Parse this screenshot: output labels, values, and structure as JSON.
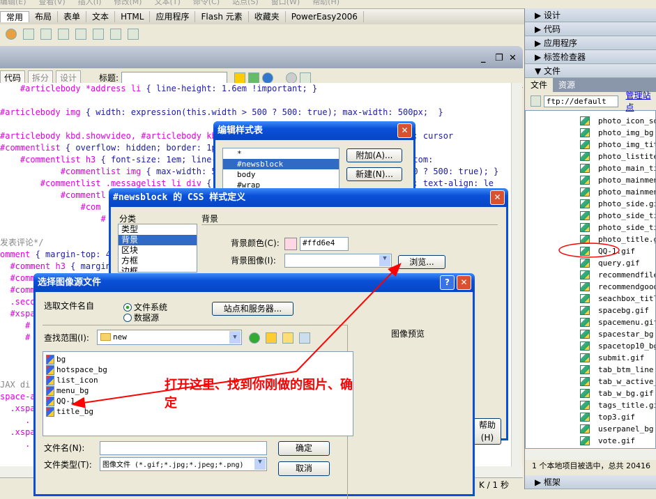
{
  "menubar": [
    "编辑(E)",
    "查看(V)",
    "插入(I)",
    "修改(M)",
    "文本(T)",
    "命令(C)",
    "站点(S)",
    "窗口(W)",
    "帮助(H)"
  ],
  "insert_tabs": [
    "常用",
    "布局",
    "表单",
    "文本",
    "HTML",
    "应用程序",
    "Flash 元素",
    "收藏夹",
    "PowerEasy2006"
  ],
  "doc_toolbar": {
    "code": "代码",
    "split": "拆分",
    "design": "设计",
    "title_label": "标题:",
    "title_value": ""
  },
  "code_lines": [
    {
      "s": "    #articlebody *address li ",
      "b": "{ line-height: 1.6em !important; }"
    },
    {
      "s": "",
      "b": ""
    },
    {
      "s": "#articlebody img ",
      "b": "{ width: expression(this.width > 500 ? 500: true); max-width: 500px;  }"
    },
    {
      "s": "",
      "b": ""
    },
    {
      "s": "#articlebody kbd.showvideo, #articlebody kbd.showvideo a ",
      "b": "{ font-family: sans-serif; cursor"
    },
    {
      "s": "#commentlist ",
      "b": "{ overflow: hidden; border: 1px solid #ccc; padding: 0 5px; }"
    },
    {
      "s": "    #commentlist h3 ",
      "b": "{ font-size: 1em; line-height: 2em; color: #0000FF; border-bottom:"
    },
    {
      "s": "            #commentlist img ",
      "b": "{ max-width: 500px; width: expression(this.width > 500 ? 500: true); }"
    },
    {
      "s": "        #commentlist .messagelist li div ",
      "b": "{ margin: 0; padding: 0; overflow: hidden; text-align: le"
    },
    {
      "s": "            #commentl",
      "b": ""
    },
    {
      "s": "                #com",
      "b": ""
    },
    {
      "s": "                    #",
      "b": ""
    },
    {
      "s": "",
      "b": ""
    },
    {
      "c": "发表评论*/"
    },
    {
      "s": "omment ",
      "b": "{ margin-top: 4px; }"
    },
    {
      "s": "  #comment h3 ",
      "b": "{ margin: 0; }"
    },
    {
      "s": "  #comm",
      "b": ""
    },
    {
      "s": "  #comm",
      "b": ""
    },
    {
      "s": "  .seco",
      "b": ""
    },
    {
      "s": "  #xspa",
      "b": ""
    },
    {
      "s": "     #",
      "b": ""
    },
    {
      "s": "     #",
      "b": ""
    },
    {
      "s": "",
      "b": ""
    },
    {
      "s": "",
      "b": ""
    },
    {
      "s": "",
      "b": ""
    },
    {
      "c": "JAX di"
    },
    {
      "s": "space-a",
      "b": ""
    },
    {
      "s": "  .xspa",
      "b": ""
    },
    {
      "s": "     .",
      "b": ""
    },
    {
      "s": "  .xspa",
      "b": ""
    },
    {
      "s": "     .",
      "b": ""
    }
  ],
  "status_right": "K / 1 秒",
  "panel": {
    "groups": [
      "设计",
      "代码",
      "应用程序",
      "标签检查器"
    ],
    "files_group": "文件",
    "tabs": [
      "文件",
      "资源"
    ],
    "site": "ftp://default",
    "manage": "管理站点",
    "files": [
      "photo_icon_squ",
      "photo_img_bg.g",
      "photo_img_titl",
      "photo_listitem",
      "photo_main_tit",
      "photo_mainmenu",
      "photo_mainmenu",
      "photo_side.gif",
      "photo_side_tit",
      "photo_side_tit",
      "photo_title.gi",
      "QQ-1.gif",
      "query.gif",
      "recommendfile_",
      "recommendgoods",
      "seachbox_title",
      "spacebg.gif",
      "spacemenu.gif",
      "spacestar_bg.g",
      "spacetop10_bg.",
      "submit.gif",
      "tab_btm_line.g",
      "tab_w_active_b",
      "tab_w_bg.gif",
      "tags_title.gif",
      "top3.gif",
      "userpanel_bg.g",
      "vote.gif"
    ],
    "status": "1 个本地项目被选中，总共 20416",
    "frames_group": "框架"
  },
  "edit_stylesheet": {
    "title": "编辑样式表",
    "items": [
      "*",
      "#newsblock",
      "body",
      "#wrap"
    ],
    "selected": "#newsblock",
    "attach": "附加(A)...",
    "new": "新建(N)..."
  },
  "css_def": {
    "title": "#newsblock 的 CSS 样式定义",
    "category_label": "分类",
    "categories": [
      "类型",
      "背景",
      "区块",
      "方框",
      "边框",
      "列表"
    ],
    "selected": "背景",
    "section": "背景",
    "bg_color_label": "背景颜色(C):",
    "bg_color_value": "#ffd6e4",
    "bg_color": "#ffd6e4",
    "bg_image_label": "背景图像(I):",
    "bg_image_value": "",
    "browse": "浏览...",
    "help": "帮助(H)"
  },
  "select_image": {
    "title": "选择图像源文件",
    "source_label": "选取文件名自",
    "radio_fs": "文件系统",
    "radio_ds": "数据源",
    "fs_selected": true,
    "sites_btn": "站点和服务器...",
    "lookin_label": "查找范围(I):",
    "lookin_value": "new",
    "preview": "图像预览",
    "files": [
      "bg",
      "hotspace_bg",
      "list_icon",
      "menu_bg",
      "QQ-1",
      "title_bg"
    ],
    "filename_label": "文件名(N):",
    "filename_value": "",
    "filetype_label": "文件类型(T):",
    "filetype_value": "图像文件 (*.gif;*.jpg;*.jpeg;*.png)",
    "ok": "确定",
    "cancel": "取消"
  },
  "annotation": "打开这里、找到你刚做的图片、确定",
  "annotation_color": "#ff0000"
}
